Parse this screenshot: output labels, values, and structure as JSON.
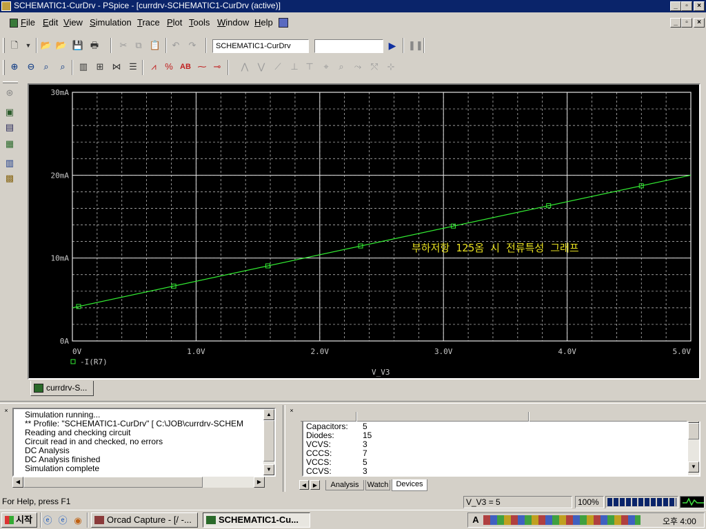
{
  "window": {
    "title": "SCHEMATIC1-CurDrv - PSpice  - [currdrv-SCHEMATIC1-CurDrv (active)]"
  },
  "menu": {
    "items": [
      {
        "label": "File",
        "ul": "F",
        "rest": "ile"
      },
      {
        "label": "Edit",
        "ul": "E",
        "rest": "dit"
      },
      {
        "label": "View",
        "ul": "V",
        "rest": "iew"
      },
      {
        "label": "Simulation",
        "ul": "S",
        "rest": "imulation"
      },
      {
        "label": "Trace",
        "ul": "T",
        "rest": "race"
      },
      {
        "label": "Plot",
        "ul": "P",
        "rest": "lot"
      },
      {
        "label": "Tools",
        "ul": "T",
        "rest": "ools"
      },
      {
        "label": "Window",
        "ul": "W",
        "rest": "indow"
      },
      {
        "label": "Help",
        "ul": "H",
        "rest": "elp"
      }
    ]
  },
  "toolbar": {
    "profile_combo_value": "SCHEMATIC1-CurDrv",
    "second_combo_value": ""
  },
  "chart_data": {
    "type": "line",
    "xlabel": "V_V3",
    "ylabel": "",
    "xlim": [
      0,
      5
    ],
    "ylim": [
      0,
      30
    ],
    "x_ticks": [
      "0V",
      "1.0V",
      "2.0V",
      "3.0V",
      "4.0V",
      "5.0V"
    ],
    "y_ticks": [
      "0A",
      "10mA",
      "20mA",
      "30mA"
    ],
    "y_tick_values": [
      0,
      10,
      20,
      30
    ],
    "grid": true,
    "legend_placement": "bottom-left",
    "annotation": "부하저항 125옴 시 전류특성 그래프",
    "series": [
      {
        "name": "-I(R7)",
        "color": "#33ee33",
        "x": [
          0,
          5
        ],
        "y": [
          4.0,
          20.0
        ],
        "marker_x": [
          0.05,
          0.82,
          1.58,
          2.33,
          3.08,
          3.85,
          4.6
        ],
        "marker_y": [
          4.16,
          6.62,
          9.06,
          11.46,
          13.86,
          16.32,
          18.72
        ]
      }
    ],
    "annotation_color": "#e8e020"
  },
  "doc_tab": {
    "label": "currdrv-S..."
  },
  "output": {
    "lines": [
      "Simulation running...",
      "** Profile: \"SCHEMATIC1-CurDrv\"  [ C:\\JOB\\currdrv-SCHEM",
      "Reading and checking circuit",
      "Circuit read in and checked, no errors",
      "DC Analysis",
      "DC Analysis finished",
      "Simulation complete"
    ]
  },
  "devices": {
    "rows": [
      {
        "name": "Capacitors:",
        "value": "5"
      },
      {
        "name": "Diodes:",
        "value": "15"
      },
      {
        "name": "VCVS:",
        "value": "3"
      },
      {
        "name": "CCCS:",
        "value": "7"
      },
      {
        "name": "VCCS:",
        "value": "5"
      },
      {
        "name": "CCVS:",
        "value": "3"
      }
    ],
    "tabs": [
      "Analysis",
      "Watch",
      "Devices"
    ],
    "active_tab": "Devices"
  },
  "status": {
    "help": "For Help, press F1",
    "readout": "V_V3 =  5",
    "zoom": "100%",
    "progress_fraction": 1.0
  },
  "taskbar": {
    "start_label": "시작",
    "tasks": [
      {
        "label": "Orcad Capture - [/ -..."
      },
      {
        "label": "SCHEMATIC1-Cu..."
      }
    ],
    "clock": "오후 4:00"
  }
}
